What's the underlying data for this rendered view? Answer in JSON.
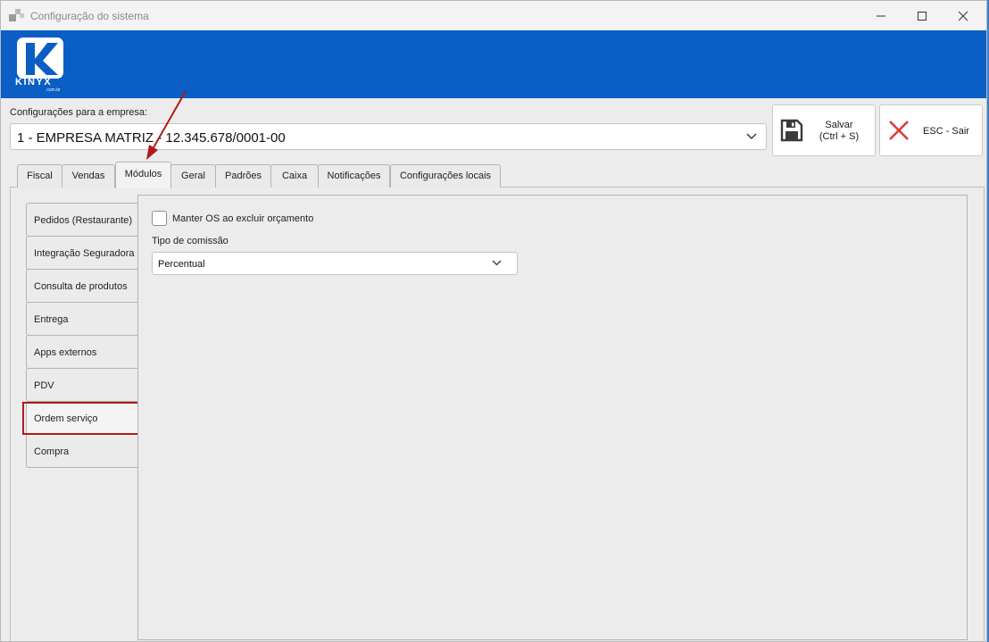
{
  "window": {
    "title": "Configuração do sistema"
  },
  "brand": {
    "logo_text": "KINYX",
    "logo_sub": ".com.br",
    "banner_color": "#0a5ec4"
  },
  "company": {
    "label": "Configurações para a empresa:",
    "selected": "1 - EMPRESA MATRIZ - 12.345.678/0001-00"
  },
  "toolbar": {
    "save_label_line1": "Salvar",
    "save_label_line2": "(Ctrl + S)",
    "exit_label": "ESC - Sair"
  },
  "tabs": [
    {
      "label": "Fiscal"
    },
    {
      "label": "Vendas"
    },
    {
      "label": "Módulos",
      "active": true
    },
    {
      "label": "Geral"
    },
    {
      "label": "Padrões"
    },
    {
      "label": "Caixa"
    },
    {
      "label": "Notificações"
    },
    {
      "label": "Configurações locais"
    }
  ],
  "module_tabs": [
    {
      "label": "Pedidos (Restaurante)"
    },
    {
      "label": "Integração Seguradora"
    },
    {
      "label": "Consulta de produtos"
    },
    {
      "label": "Entrega"
    },
    {
      "label": "Apps externos"
    },
    {
      "label": "PDV"
    },
    {
      "label": "Ordem serviço",
      "active": true
    },
    {
      "label": "Compra"
    }
  ],
  "ordem_servico": {
    "keep_os_label": "Manter OS ao excluir orçamento",
    "keep_os_checked": false,
    "commission_label": "Tipo de comissão",
    "commission_value": "Percentual"
  },
  "annotation": {
    "highlight_color": "#b01a1a"
  }
}
